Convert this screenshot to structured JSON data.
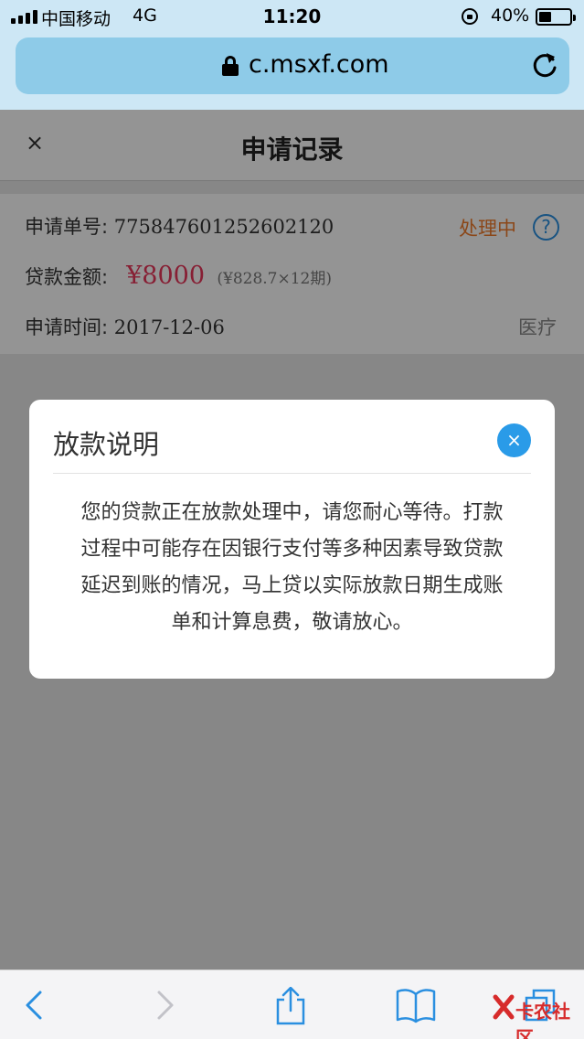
{
  "status_bar": {
    "carrier": "中国移动",
    "network": "4G",
    "time": "11:20",
    "battery": "40%",
    "battery_level": 0.4
  },
  "browser": {
    "url": "c.msxf.com"
  },
  "header": {
    "title": "申请记录",
    "close_symbol": "×"
  },
  "record": {
    "order_label": "申请单号:",
    "order_number": "775847601252602120",
    "status": "处理中",
    "help_symbol": "?",
    "amount_label": "贷款金额:",
    "amount": "¥8000",
    "installment": "(¥828.7×12期)",
    "date_label": "申请时间:",
    "date": "2017-12-06",
    "category": "医疗"
  },
  "dialog": {
    "title": "放款说明",
    "close_symbol": "×",
    "lines": [
      "您的贷款正在放款处理中，请您耐心等待。打款",
      "过程中可能存在因银行支付等多种因素导致贷款",
      "延迟到账的情况，马上贷以实际放款日期生成账",
      "单和计算息费，敬请放心。"
    ]
  },
  "toolbar": {
    "icons": [
      "back-icon",
      "forward-icon",
      "share-icon",
      "bookmarks-icon",
      "tabs-icon"
    ]
  },
  "watermark": {
    "text": "卡农社区"
  },
  "colors": {
    "status_orange": "#f07a2b",
    "amount_red": "#e8365a",
    "accent_blue": "#2a9be8",
    "ios_blue": "#2a8fe0"
  }
}
